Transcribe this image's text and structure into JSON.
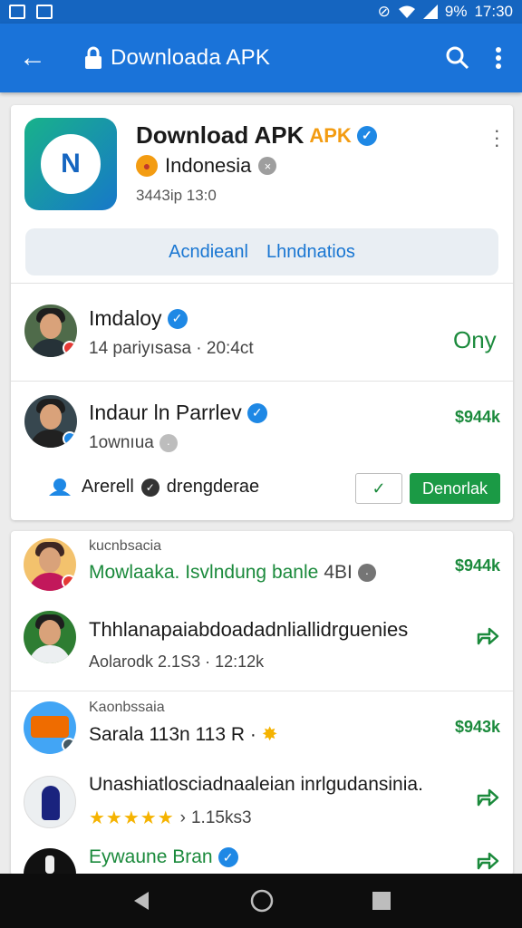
{
  "status_bar": {
    "time": "17:30",
    "battery": "9%"
  },
  "app_bar": {
    "title": "Downloada APK"
  },
  "app_card": {
    "title": "Download APK",
    "title_badge": "APK",
    "country": "Indonesia",
    "meta": "3443ip 13:0",
    "icon_letter": "N",
    "tab_left": "Acndieanl",
    "tab_right": "Lhndnatios"
  },
  "rows": [
    {
      "name": "Imdaloy",
      "sub": "14 pariyısasa · 20:4ct",
      "right": "Ony"
    },
    {
      "name": "Indaur ln Parrlev",
      "sub": "1ownıua",
      "right": "$944k"
    }
  ],
  "actions": {
    "label_left": "Arerell",
    "label_right": "drengderae",
    "outline_button": "✓",
    "primary_button": "Denorlak"
  },
  "feed": {
    "section1_label": "kucnbsacia",
    "item1_title": "Mowlaaka. Isvlndung banle",
    "item1_extra": "4BI",
    "item1_price": "$944k",
    "item2_title": "Thhlanapaiabdoadadnliallidrguenies",
    "item2_sub": "Aolarodk 2.1S3 · 12:12k",
    "section2_label": "Kaonbssaia",
    "item3_title": "Sarala 113n 113 R ·",
    "item3_price": "$943k",
    "item4_title": "Unashiatlosciadnaaleian inrlgudansinia.",
    "item4_rating_text": "1.15ks3",
    "item5_title": "Eywaune Bran"
  }
}
